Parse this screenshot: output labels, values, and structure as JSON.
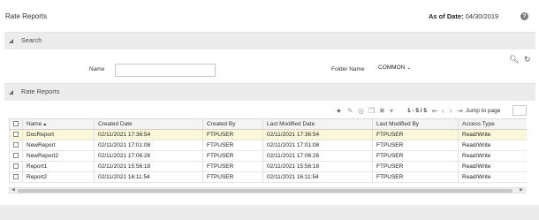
{
  "header": {
    "title": "Rate Reports",
    "as_of_label": "As of Date:",
    "as_of_value": "04/30/2019",
    "help_icon": "help-icon"
  },
  "search_section": {
    "title": "Search",
    "name_label": "Name",
    "name_value": "",
    "folder_label": "Folder Name",
    "folder_value": "COMMON",
    "icons": [
      "search-icon",
      "reset-icon"
    ]
  },
  "reports_section": {
    "title": "Rate Reports",
    "toolbar": {
      "icons": [
        "add-icon",
        "edit-icon",
        "view-icon",
        "copy-icon",
        "delete-icon",
        "more-icon"
      ],
      "pager_text": "1 - 5 / 5",
      "jump_label": "Jump to page"
    },
    "columns": [
      "Name",
      "Created Date",
      "Created By",
      "Last Modified Date",
      "Last Modified By",
      "Access Type"
    ],
    "rows": [
      [
        "DocReport",
        "02/11/2021 17:36:54",
        "FTPUSER",
        "02/11/2021 17:36:54",
        "FTPUSER",
        "Read/Write"
      ],
      [
        "NewReport",
        "02/11/2021 17:01:08",
        "FTPUSER",
        "02/11/2021 17:01:08",
        "FTPUSER",
        "Read/Write"
      ],
      [
        "NewReport2",
        "02/11/2021 17:06:26",
        "FTPUSER",
        "02/11/2021 17:06:26",
        "FTPUSER",
        "Read/Write"
      ],
      [
        "Report1",
        "02/11/2021 15:56:18",
        "FTPUSER",
        "02/11/2021 15:56:18",
        "FTPUSER",
        "Read/Write"
      ],
      [
        "Report2",
        "02/11/2021 16:11:54",
        "FTPUSER",
        "02/11/2021 16:11:54",
        "FTPUSER",
        "Read/Write"
      ]
    ],
    "selected_row": 0
  }
}
